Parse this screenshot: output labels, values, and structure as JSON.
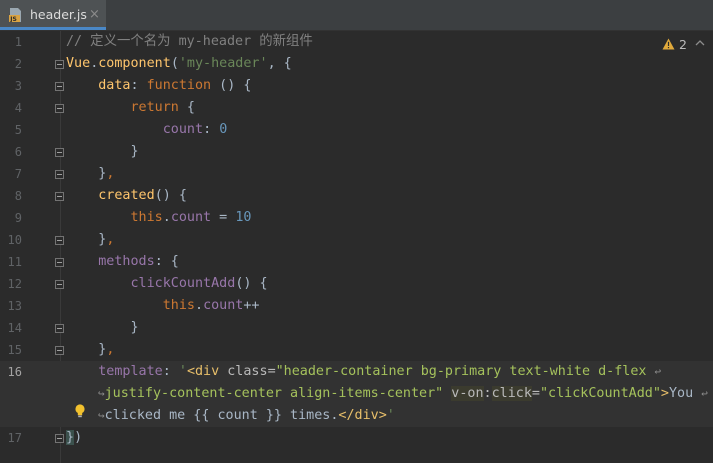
{
  "tab": {
    "label": "header.js",
    "close": "×",
    "icon": "js-file-icon",
    "badge": "JS"
  },
  "warnings": {
    "count": "2",
    "icon": "warning-triangle-icon"
  },
  "lines": [
    {
      "num": "1",
      "text": "// 定义一个名为 my-header 的新组件"
    },
    {
      "num": "2",
      "text": "Vue.component('my-header', {"
    },
    {
      "num": "3",
      "text": "    data: function () {"
    },
    {
      "num": "4",
      "text": "        return {"
    },
    {
      "num": "5",
      "text": "            count: 0"
    },
    {
      "num": "6",
      "text": "        }"
    },
    {
      "num": "7",
      "text": "    },"
    },
    {
      "num": "8",
      "text": "    created() {"
    },
    {
      "num": "9",
      "text": "        this.count = 10"
    },
    {
      "num": "10",
      "text": "    },"
    },
    {
      "num": "11",
      "text": "    methods: {"
    },
    {
      "num": "12",
      "text": "        clickCountAdd() {"
    },
    {
      "num": "13",
      "text": "            this.count++"
    },
    {
      "num": "14",
      "text": "        }"
    },
    {
      "num": "15",
      "text": "    },"
    },
    {
      "num": "16",
      "text": "    template: '<div class=\"header-container bg-primary text-white d-flex justify-content-center align-items-center\" v-on:click=\"clickCountAdd\">You clicked me {{ count }} times.</div>'"
    },
    {
      "num": "17",
      "text": "})"
    }
  ],
  "tokens": {
    "l1": "// 定义一个名为 my-header 的新组件",
    "l2_vue": "Vue",
    "l2_dot": ".",
    "l2_component": "component",
    "l2_paren": "(",
    "l2_str": "'my-header'",
    "l2_rest": ", {",
    "l3_data": "data",
    "l3_colon": ": ",
    "l3_function": "function",
    "l3_rest": " () {",
    "l4_return": "return",
    "l4_rest": " {",
    "l5_count": "count",
    "l5_colon": ": ",
    "l5_zero": "0",
    "l6": "}",
    "l7_brace": "}",
    "l7_comma": ",",
    "l8_created": "created",
    "l8_rest": "() {",
    "l9_this": "this",
    "l9_dot": ".",
    "l9_count": "count",
    "l9_eq": " = ",
    "l9_ten": "10",
    "l10_brace": "}",
    "l10_comma": ",",
    "l11_methods": "methods",
    "l11_rest": ": {",
    "l12_fn": "clickCountAdd",
    "l12_rest": "() {",
    "l13_this": "this",
    "l13_dot": ".",
    "l13_count": "count",
    "l13_pp": "++",
    "l14": "}",
    "l15_brace": "}",
    "l15_comma": ",",
    "l16a_template": "template",
    "l16a_colon": ": ",
    "l16a_q": "'",
    "l16a_open": "<div ",
    "l16a_class": "class",
    "l16a_eq": "=",
    "l16a_val": "\"header-container bg-primary text-white d-flex",
    "l16b_val": "justify-content-center align-items-center\"",
    "l16b_von": "v-on",
    "l16b_colon": ":",
    "l16b_click": "click",
    "l16b_eq": "=",
    "l16b_val2": "\"clickCountAdd\"",
    "l16b_gt": ">",
    "l16b_you": "You",
    "l16c_text": "clicked me {{ count }} times.",
    "l16c_close": "</div>",
    "l16c_q": "'",
    "l17_brace": "}",
    "l17_paren": ")",
    "wrap_out": "↩",
    "wrap_in": "↪"
  },
  "colors": {
    "background": "#2b2b2b",
    "keyword": "#cc7832",
    "string": "#6a8759",
    "property": "#9876aa",
    "number": "#6897bb",
    "function": "#ffc66d",
    "comment": "#808080",
    "tab_underline": "#4a88c7"
  }
}
